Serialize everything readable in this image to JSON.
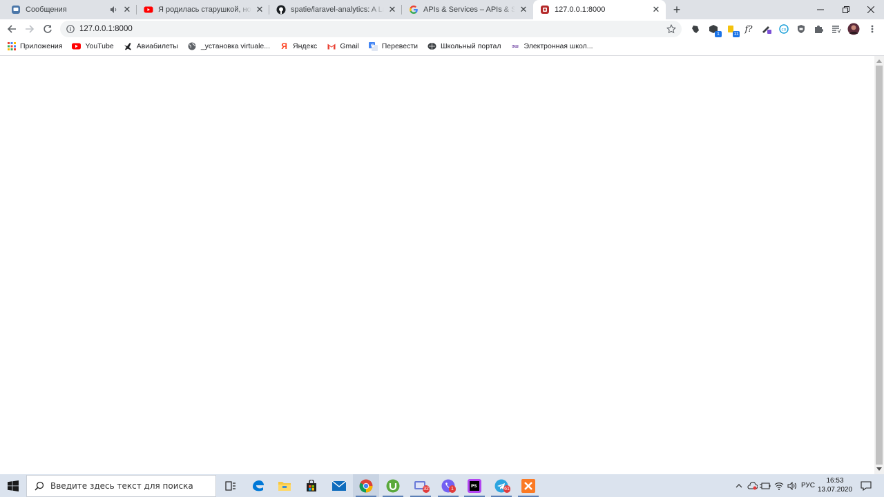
{
  "browser": {
    "tabs": [
      {
        "title": "Сообщения",
        "favicon": "vk-messages-icon",
        "audio": true
      },
      {
        "title": "Я родилась старушкой, но с каждым годом",
        "favicon": "youtube-icon",
        "audio": false
      },
      {
        "title": "spatie/laravel-analytics: A Laravel package",
        "favicon": "github-icon",
        "audio": false
      },
      {
        "title": "APIs & Services – APIs & Services – Google Cloud",
        "favicon": "google-icon",
        "audio": false
      },
      {
        "title": "127.0.0.1:8000",
        "favicon": "laravel-icon",
        "audio": false,
        "active": true
      }
    ],
    "new_tab_label": "+",
    "url": "127.0.0.1:8000",
    "extension_badges": {
      "ext2": "1",
      "ext3": "11"
    }
  },
  "bookmarks": [
    {
      "label": "Приложения",
      "icon": "apps-grid-icon"
    },
    {
      "label": "YouTube",
      "icon": "youtube-icon"
    },
    {
      "label": "Авиабилеты",
      "icon": "plane-icon"
    },
    {
      "label": "_установка virtuale...",
      "icon": "globe-icon"
    },
    {
      "label": "Яндекс",
      "icon": "yandex-icon"
    },
    {
      "label": "Gmail",
      "icon": "gmail-icon"
    },
    {
      "label": "Перевести",
      "icon": "translate-icon"
    },
    {
      "label": "Школьный портал",
      "icon": "school-portal-icon"
    },
    {
      "label": "Электронная школ...",
      "icon": "e-school-icon"
    }
  ],
  "taskbar": {
    "search_placeholder": "Введите здесь текст для поиска",
    "apps": [
      "task-view",
      "edge",
      "file-explorer",
      "store",
      "mail",
      "chrome",
      "utorrent",
      "app-badge",
      "viber",
      "phpstorm",
      "telegram",
      "xampp"
    ],
    "badges": {
      "app7": "32",
      "viber": "1",
      "telegram": "61"
    },
    "language": "РУС",
    "time": "16:53",
    "date": "13.07.2020"
  },
  "colors": {
    "tab_strip": "#dee1e6",
    "taskbar": "#dbe3ee",
    "accent": "#1a73e8"
  }
}
